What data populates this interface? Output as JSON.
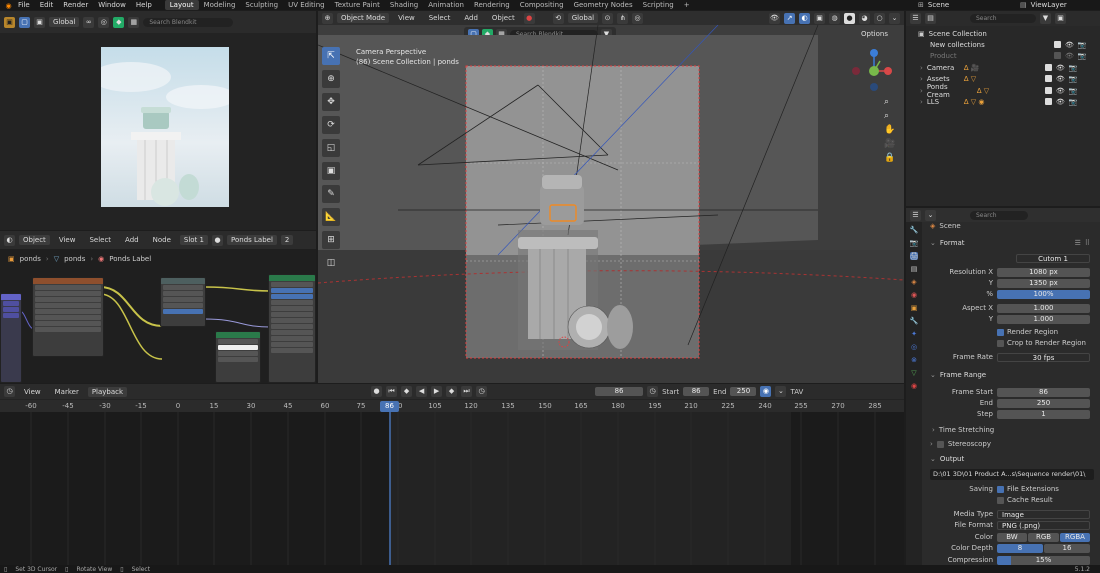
{
  "topbar": {
    "menus": [
      "File",
      "Edit",
      "Render",
      "Window",
      "Help"
    ],
    "workspaces": [
      "Layout",
      "Modeling",
      "Sculpting",
      "UV Editing",
      "Texture Paint",
      "Shading",
      "Animation",
      "Rendering",
      "Compositing",
      "Geometry Nodes",
      "Scripting"
    ],
    "active_workspace": "Layout",
    "add_tab": "+",
    "scene": "Scene",
    "view_layer": "ViewLayer"
  },
  "image_editor": {
    "transform": "Global",
    "search_placeholder": "Search Blendkit"
  },
  "viewport": {
    "mode": "Object Mode",
    "menus": [
      "View",
      "Select",
      "Add",
      "Object"
    ],
    "transform": "Global",
    "options": "Options",
    "search_placeholder": "Search Blendkit",
    "overlay_line1": "Camera Perspective",
    "overlay_line2": "(86) Scene Collection | ponds"
  },
  "node_editor": {
    "mode": "Object",
    "menus": [
      "View",
      "Select",
      "Add",
      "Node"
    ],
    "slot": "Slot 1",
    "material": "Ponds Label",
    "users": "2",
    "breadcrumb": [
      "ponds",
      "ponds",
      "Ponds Label"
    ]
  },
  "outliner": {
    "search_placeholder": "Search",
    "root": "Scene Collection",
    "items": [
      "New collections",
      "Product",
      "Camera",
      "Assets",
      "Ponds Cream",
      "LLS"
    ]
  },
  "properties": {
    "search_placeholder": "Search",
    "context": "Scene",
    "format": {
      "title": "Format",
      "preset": "Cutom 1",
      "res_x_label": "Resolution X",
      "res_x": "1080 px",
      "y_label": "Y",
      "res_y": "1350 px",
      "pct_label": "%",
      "pct": "100%",
      "aspect_x_label": "Aspect X",
      "aspect_x": "1.000",
      "aspect_y": "1.000",
      "render_region": "Render Region",
      "crop": "Crop to Render Region",
      "frame_rate_label": "Frame Rate",
      "frame_rate": "30 fps"
    },
    "frame_range": {
      "title": "Frame Range",
      "start_label": "Frame Start",
      "start": "86",
      "end_label": "End",
      "end": "250",
      "step_label": "Step",
      "step": "1"
    },
    "time_stretching": "Time Stretching",
    "stereoscopy": "Stereoscopy",
    "output": {
      "title": "Output",
      "path": "D:\\01 3D\\01 Product A...s\\Sequence render\\01\\",
      "saving_label": "Saving",
      "file_ext": "File Extensions",
      "cache": "Cache Result",
      "media_type_label": "Media Type",
      "media_type": "Image",
      "file_format_label": "File Format",
      "file_format": "PNG (.png)",
      "color_label": "Color",
      "color_opts": [
        "BW",
        "RGB",
        "RGBA"
      ],
      "depth_label": "Color Depth",
      "depth_opts": [
        "8",
        "16"
      ],
      "compression_label": "Compression",
      "compression": "15%"
    }
  },
  "timeline": {
    "menus": [
      "View",
      "Marker",
      "Playback"
    ],
    "current": "86",
    "start_label": "Start",
    "start": "86",
    "end_label": "End",
    "end": "250",
    "keying": "TAV",
    "ticks": [
      "-60",
      "-45",
      "-30",
      "-15",
      "0",
      "15",
      "30",
      "45",
      "60",
      "75",
      "90",
      "105",
      "120",
      "135",
      "150",
      "165",
      "180",
      "195",
      "210",
      "225",
      "240",
      "255",
      "270",
      "285"
    ],
    "playhead": "86"
  },
  "statusbar": {
    "items": [
      "Set 3D Cursor",
      "Rotate View",
      "Select"
    ],
    "version": "5.1.2"
  }
}
